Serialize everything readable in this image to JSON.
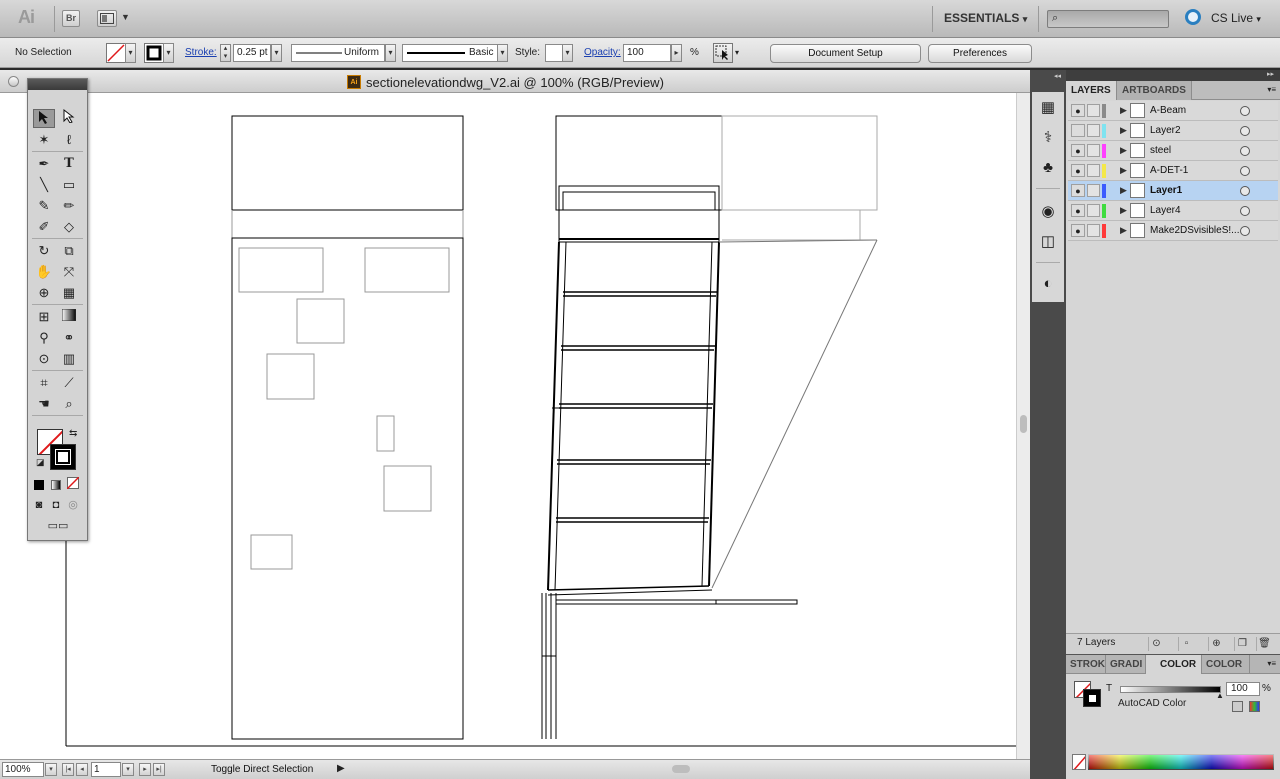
{
  "app": {
    "logo": "Ai",
    "bridge_label": "Br",
    "workspace": "ESSENTIALS",
    "cslive": "CS Live"
  },
  "control": {
    "selection": "No Selection",
    "stroke_label": "Stroke:",
    "stroke_value": "0.25 pt",
    "profile_uniform": "Uniform",
    "brush_basic": "Basic",
    "style_label": "Style:",
    "opacity_label": "Opacity:",
    "opacity_value": "100",
    "percent": "%",
    "document_setup": "Document Setup",
    "preferences": "Preferences"
  },
  "document": {
    "file_icon": "Ai",
    "title": "sectionelevationdwg_V2.ai @ 100% (RGB/Preview)"
  },
  "status": {
    "zoom": "100%",
    "artboard": "1",
    "tool": "Toggle Direct Selection"
  },
  "layers_panel": {
    "tabs": [
      "LAYERS",
      "ARTBOARDS"
    ],
    "layers": [
      {
        "name": "A-Beam",
        "color": "#8a8a8a",
        "visible": true,
        "selected": false
      },
      {
        "name": "Layer2",
        "color": "#7fe3f0",
        "visible": false,
        "selected": false
      },
      {
        "name": "steel",
        "color": "#ff40ff",
        "visible": true,
        "selected": false
      },
      {
        "name": "A-DET-1",
        "color": "#f4e84a",
        "visible": true,
        "selected": false
      },
      {
        "name": "Layer1",
        "color": "#3a5bff",
        "visible": true,
        "selected": true
      },
      {
        "name": "Layer4",
        "color": "#3fdc3f",
        "visible": true,
        "selected": false
      },
      {
        "name": "Make2DSvisibleS!...",
        "color": "#ff3a3a",
        "visible": true,
        "selected": false
      }
    ],
    "count": "7 Layers"
  },
  "color_panel": {
    "tabs": [
      "STROK",
      "GRADI",
      "COLOR",
      "COLOR"
    ],
    "channel": "T",
    "value": "100",
    "percent": "%",
    "mode": "AutoCAD Color"
  },
  "colors": {
    "accent": "#2a7fc0",
    "selection_row": "#b7d3f2"
  }
}
